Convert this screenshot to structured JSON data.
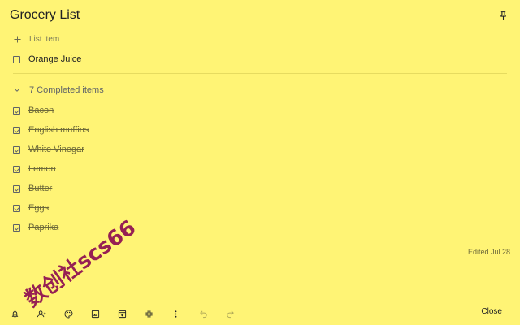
{
  "note": {
    "title": "Grocery List",
    "add_placeholder": "List item",
    "active_items": [
      {
        "label": "Orange Juice"
      }
    ],
    "completed_header": "7 Completed items",
    "completed_items": [
      {
        "label": "Bacon"
      },
      {
        "label": "English muffins"
      },
      {
        "label": "White Vinegar"
      },
      {
        "label": "Lemon"
      },
      {
        "label": "Butter"
      },
      {
        "label": "Eggs"
      },
      {
        "label": "Paprika"
      }
    ],
    "edited": "Edited Jul 28",
    "background_color": "#fff475"
  },
  "watermark": "数创社scs66",
  "toolbar": {
    "icons": [
      "remind-me-icon",
      "collaborator-icon",
      "palette-icon",
      "add-image-icon",
      "archive-icon",
      "collapse-icon",
      "more-icon",
      "undo-icon",
      "redo-icon"
    ],
    "close_label": "Close"
  }
}
